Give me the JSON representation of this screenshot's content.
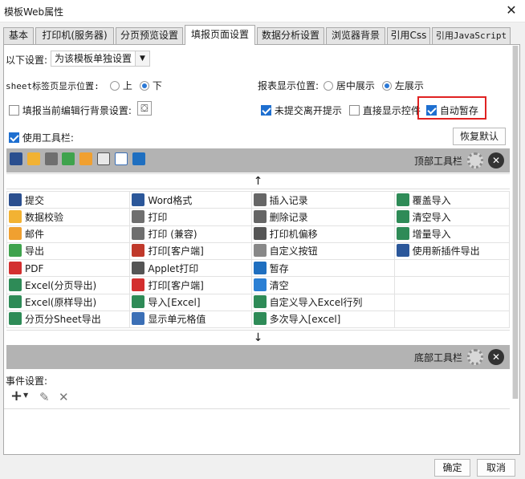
{
  "window": {
    "title": "模板Web属性",
    "close_glyph": "✕"
  },
  "tabs": [
    "基本",
    "打印机(服务器)",
    "分页预览设置",
    "填报页面设置",
    "数据分析设置",
    "浏览器背景",
    "引用Css",
    "引用JavaScript"
  ],
  "settings": {
    "scope_label": "以下设置:",
    "scope_value": "为该模板单独设置",
    "sheet_pos_label": "sheet标签页显示位置:",
    "sheet_pos_options": [
      "上",
      "下"
    ],
    "sheet_pos_selected": "下",
    "report_pos_label": "报表显示位置:",
    "report_pos_options": [
      "居中展示",
      "左展示"
    ],
    "report_pos_selected": "左展示",
    "fill_bg_label": "填报当前编辑行背景设置:",
    "fill_bg_checked": false,
    "unsubmitted_label": "未提交离开提示",
    "unsubmitted_checked": true,
    "direct_show_label": "直接显示控件",
    "direct_show_checked": false,
    "autosave_label": "自动暂存",
    "autosave_checked": true,
    "use_toolbar_label": "使用工具栏:",
    "use_toolbar_checked": true,
    "restore_default": "恢复默认"
  },
  "top_toolbar": {
    "label": "顶部工具栏",
    "icons": [
      "save-icon",
      "data-check-icon",
      "print-icon",
      "export-icon",
      "email-icon",
      "insert-record-icon",
      "show-cell-icon",
      "autosave-icon"
    ]
  },
  "bottom_toolbar": {
    "label": "底部工具栏"
  },
  "arrows": {
    "up": "↑",
    "down": "↓"
  },
  "buttons_grid": [
    [
      {
        "icon": "save-icon",
        "label": "提交"
      },
      {
        "icon": "word-icon",
        "label": "Word格式"
      },
      {
        "icon": "insert-record-icon",
        "label": "插入记录"
      },
      {
        "icon": "excel-icon",
        "label": "覆盖导入"
      }
    ],
    [
      {
        "icon": "data-check-icon",
        "label": "数据校验"
      },
      {
        "icon": "print-icon",
        "label": "打印"
      },
      {
        "icon": "delete-record-icon",
        "label": "删除记录"
      },
      {
        "icon": "excel-icon",
        "label": "清空导入"
      }
    ],
    [
      {
        "icon": "email-icon",
        "label": "邮件"
      },
      {
        "icon": "print-icon",
        "label": "打印 (兼容)"
      },
      {
        "icon": "printer-offset-icon",
        "label": "打印机偏移"
      },
      {
        "icon": "excel-icon",
        "label": "增量导入"
      }
    ],
    [
      {
        "icon": "export-icon",
        "label": "导出"
      },
      {
        "icon": "flash-print-icon",
        "label": "打印[客户端]"
      },
      {
        "icon": "gear-icon",
        "label": "自定义按钮"
      },
      {
        "icon": "word-icon",
        "label": "使用新插件导出"
      }
    ],
    [
      {
        "icon": "pdf-icon",
        "label": "PDF"
      },
      {
        "icon": "applet-icon",
        "label": "Applet打印"
      },
      {
        "icon": "autosave-icon",
        "label": "暂存"
      },
      {
        "icon": "",
        "label": ""
      }
    ],
    [
      {
        "icon": "excel-icon",
        "label": "Excel(分页导出)"
      },
      {
        "icon": "pdf-icon",
        "label": "打印[客户端]"
      },
      {
        "icon": "eraser-icon",
        "label": "清空"
      },
      {
        "icon": "",
        "label": ""
      }
    ],
    [
      {
        "icon": "excel-icon",
        "label": "Excel(原样导出)"
      },
      {
        "icon": "excel-icon",
        "label": "导入[Excel]"
      },
      {
        "icon": "excel-icon",
        "label": "自定义导入Excel行列"
      },
      {
        "icon": "",
        "label": ""
      }
    ],
    [
      {
        "icon": "excel-icon",
        "label": "分页分Sheet导出"
      },
      {
        "icon": "show-cell-icon",
        "label": "显示单元格值"
      },
      {
        "icon": "excel-icon",
        "label": "多次导入[excel]"
      },
      {
        "icon": "",
        "label": ""
      }
    ]
  ],
  "events": {
    "label": "事件设置:",
    "add_glyph": "+",
    "edit_glyph": "✎",
    "delete_glyph": "✕"
  },
  "footer": {
    "ok": "确定",
    "cancel": "取消"
  },
  "colors": {
    "highlight": "#e02222",
    "check_blue": "#1e6fd0",
    "toolbar_gray": "#b3b3b3"
  }
}
